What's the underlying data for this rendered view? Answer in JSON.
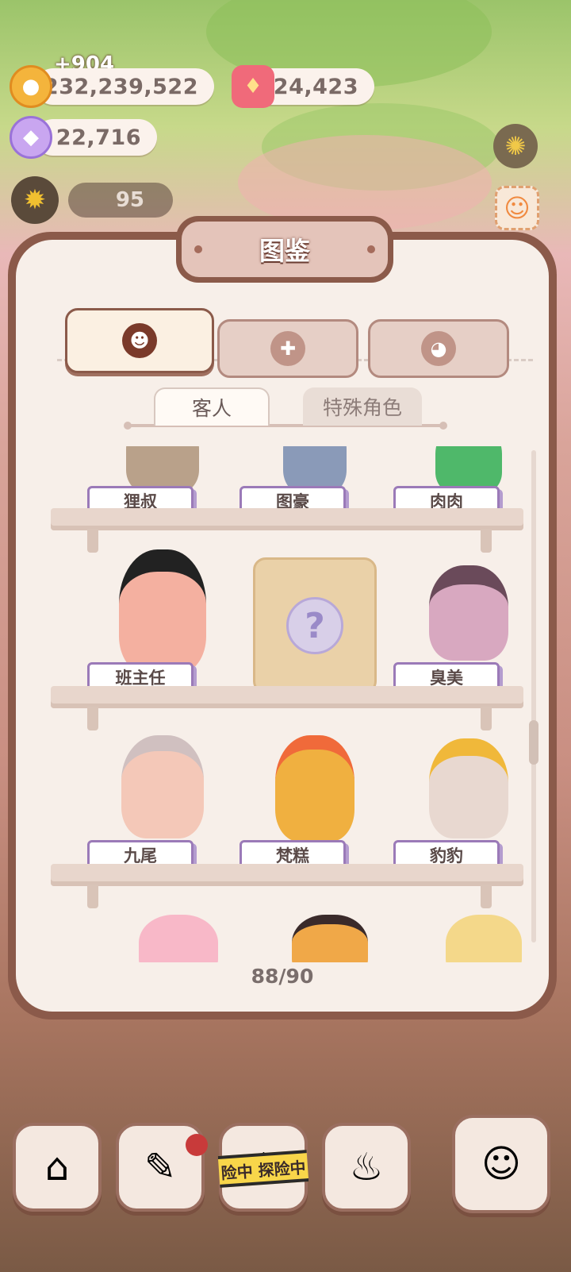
{
  "resources": {
    "gain": "+904",
    "coins": "232,239,522",
    "candles": "24,423",
    "candy": "22,716",
    "level": "95"
  },
  "panel": {
    "title": "图鉴",
    "tabs": [
      {
        "icon": "cookie-face-icon",
        "active": true
      },
      {
        "icon": "gift-icon",
        "active": false
      },
      {
        "icon": "bird-badge-icon",
        "active": false
      }
    ],
    "sub_tabs": [
      "客人",
      "特殊角色"
    ],
    "shelves": [
      {
        "row": 1,
        "items": [
          "狸叔",
          "图豪",
          "肉肉"
        ]
      },
      {
        "row": 2,
        "items": [
          "班主任",
          "",
          "臭美"
        ],
        "locked": [
          false,
          true,
          false
        ]
      },
      {
        "row": 3,
        "items": [
          "九尾",
          "梵糕",
          "豹豹"
        ]
      }
    ],
    "counter": "88/90"
  },
  "bottom_nav": {
    "banner": "险中 探险中",
    "items": [
      "mushroom-house-icon",
      "notebook-icon",
      "explore-icon",
      "kitchen-icon",
      "fish-cat-icon"
    ]
  },
  "colors": {
    "panel_border": "#8b5a4a",
    "panel_bg": "#f7efe9",
    "nameplate_border": "#9b7ab8"
  }
}
